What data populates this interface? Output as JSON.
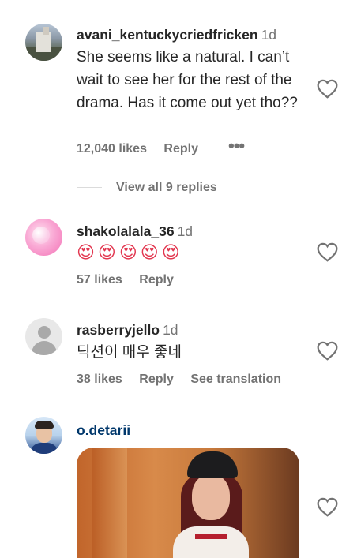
{
  "comments": [
    {
      "username": "avani_kentuckycriedfricken",
      "time": "1d",
      "text": "She seems like a natural. I can’t wait to see her for the rest of the drama. Has it come out yet tho??",
      "likes": "12,040 likes",
      "reply": "Reply",
      "more": "•••",
      "view_replies": "View all 9 replies"
    },
    {
      "username": "shakolalala_36",
      "time": "1d",
      "text": "😍😍😍😍😍",
      "likes": "57 likes",
      "reply": "Reply"
    },
    {
      "username": "rasberryjello",
      "time": "1d",
      "text": "딕션이 매우 좋네",
      "likes": "38 likes",
      "reply": "Reply",
      "see_translation": "See translation"
    },
    {
      "username": "o.detarii"
    }
  ],
  "icons": {
    "like": "heart-outline-icon",
    "more": "more-horizontal-icon"
  },
  "colors": {
    "text": "#262626",
    "muted": "#737373",
    "link_username": "#00376b"
  }
}
